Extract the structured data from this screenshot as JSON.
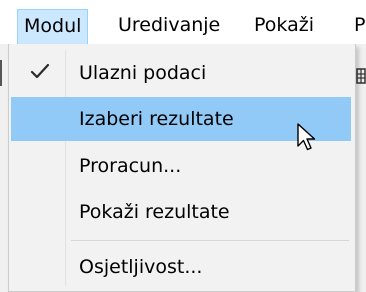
{
  "menubar": {
    "items": [
      {
        "label": "Modul"
      },
      {
        "label": "Uredivanje"
      },
      {
        "label": "Pokaži"
      },
      {
        "label": "P"
      }
    ]
  },
  "dropdown": {
    "items": [
      {
        "label": "Ulazni podaci",
        "checked": true
      },
      {
        "label": "Izaberi rezultate",
        "highlighted": true
      },
      {
        "label": "Proracun..."
      },
      {
        "label": "Pokaži rezultate"
      },
      {
        "label": "Osjetljivost..."
      }
    ]
  },
  "colors": {
    "highlight": "#91c9f7",
    "menubar_active_bg": "#cce8ff",
    "menubar_active_border": "#99d1ff",
    "dropdown_bg": "#f2f2f2"
  },
  "icons": {
    "check": "check-icon",
    "cursor": "mouse-pointer-icon",
    "toolbar_edge": "toolbar-grid-icon"
  }
}
